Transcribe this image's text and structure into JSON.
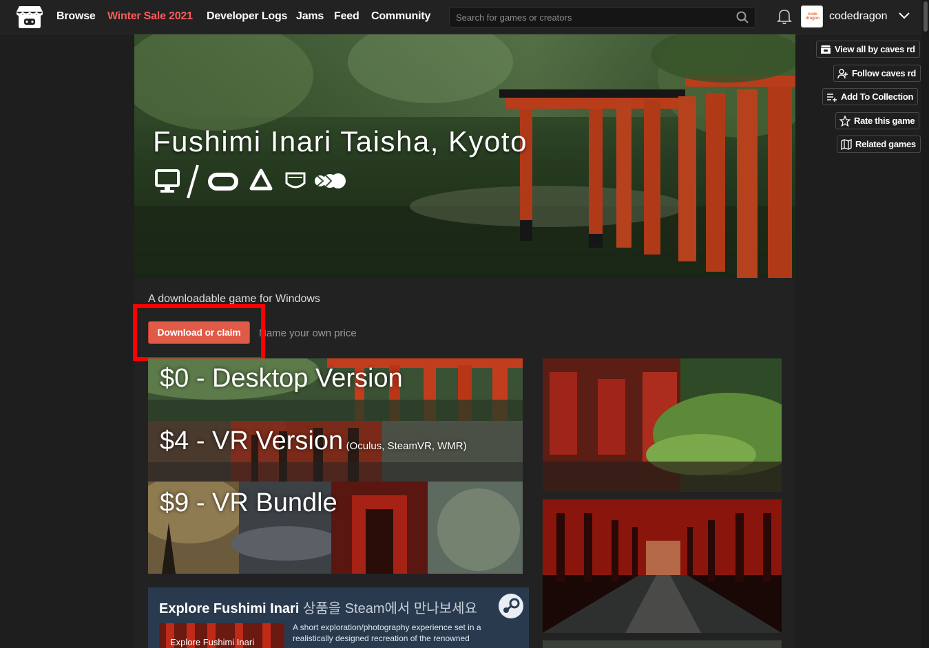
{
  "nav": {
    "links": [
      "Browse",
      "Winter Sale 2021",
      "Developer Logs",
      "Jams",
      "Feed",
      "Community"
    ],
    "search_placeholder": "Search for games or creators",
    "username": "codedragon",
    "avatar_text": "code dragon"
  },
  "actions": [
    "View all by caves rd",
    "Follow caves rd",
    "Add To Collection",
    "Rate this game",
    "Related games"
  ],
  "game": {
    "title": "Fushimi Inari Taisha, Kyoto",
    "platforms": [
      "desktop-icon",
      "oculus-icon",
      "oculus-rift-icon",
      "wmr-icon",
      "vive-icon"
    ]
  },
  "purchase": {
    "subtitle": "A downloadable game for Windows",
    "button": "Download or claim",
    "price_note": "Name your own price"
  },
  "tiers": [
    {
      "price": "$0 - Desktop Version",
      "note": ""
    },
    {
      "price": "$4 - VR Version",
      "note": "(Oculus, SteamVR, WMR)"
    },
    {
      "price": "$9 - VR Bundle",
      "note": ""
    }
  ],
  "steam": {
    "title_en": "Explore Fushimi Inari",
    "title_ko": "상품을 Steam에서 만나보세요",
    "thumb_label": "Explore Fushimi Inari",
    "description": "A short exploration/photography experience set in a realistically designed recreation of the renowned"
  },
  "colors": {
    "accent": "#fa5c5c",
    "button": "#e05a48",
    "highlight": "#ff0000",
    "steam_bg": "#2a3a4e"
  }
}
